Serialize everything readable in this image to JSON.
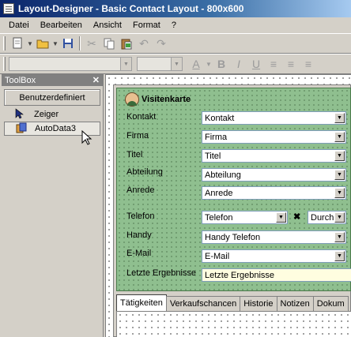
{
  "window": {
    "title": "Layout-Designer - Basic Contact Layout - 800x600"
  },
  "menu": {
    "items": [
      "Datei",
      "Bearbeiten",
      "Ansicht",
      "Format",
      "?"
    ]
  },
  "toolbox": {
    "title": "ToolBox",
    "close_glyph": "✕",
    "custom_button": "Benutzerdefiniert",
    "items": [
      {
        "label": "Zeiger",
        "icon": "pointer-icon"
      },
      {
        "label": "AutoData3",
        "icon": "autodata-icon"
      }
    ]
  },
  "card": {
    "title": "Visitenkarte",
    "fields": [
      {
        "label": "Kontakt",
        "value": "Kontakt",
        "type": "dropdown"
      },
      {
        "label": "Firma",
        "value": "Firma",
        "type": "dropdown"
      },
      {
        "label": "Titel",
        "value": "Titel",
        "type": "dropdown"
      },
      {
        "label": "Abteilung",
        "value": "Abteilung",
        "type": "dropdown"
      },
      {
        "label": "Anrede",
        "value": "Anrede",
        "type": "dropdown"
      },
      {
        "label": "Telefon",
        "value": "Telefon",
        "type": "dropdown"
      },
      {
        "label": "Handy",
        "value": "Handy Telefon",
        "type": "dropdown"
      },
      {
        "label": "E-Mail",
        "value": "E-Mail",
        "type": "dropdown"
      },
      {
        "label": "Letzte Ergebnisse",
        "value": "Letzte Ergebnisse",
        "type": "text"
      }
    ],
    "telefon_extra": {
      "x_glyph": "✖",
      "value": "Durch"
    }
  },
  "tabs": [
    "Tätigkeiten",
    "Verkaufschancen",
    "Historie",
    "Notizen",
    "Dokum"
  ],
  "colors": {
    "card_green": "#8fbf8f",
    "titlebar": "#0a246a"
  }
}
